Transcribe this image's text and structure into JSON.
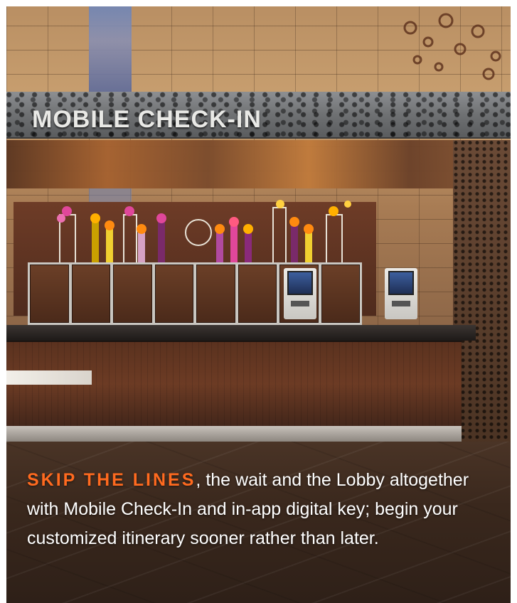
{
  "photo": {
    "sign_text": "MOBILE CHECK-IN",
    "scene_colors": {
      "stone": "#c9a070",
      "metal": "#6f7173",
      "wood": "#5b321f",
      "accent_orange": "#ff6a1f"
    }
  },
  "caption": {
    "lead": "SKIP THE LINES",
    "body": ", the wait and the Lobby altogether with Mobile Check-In and in-app digital key; begin your customized itinerary sooner rather than later."
  }
}
